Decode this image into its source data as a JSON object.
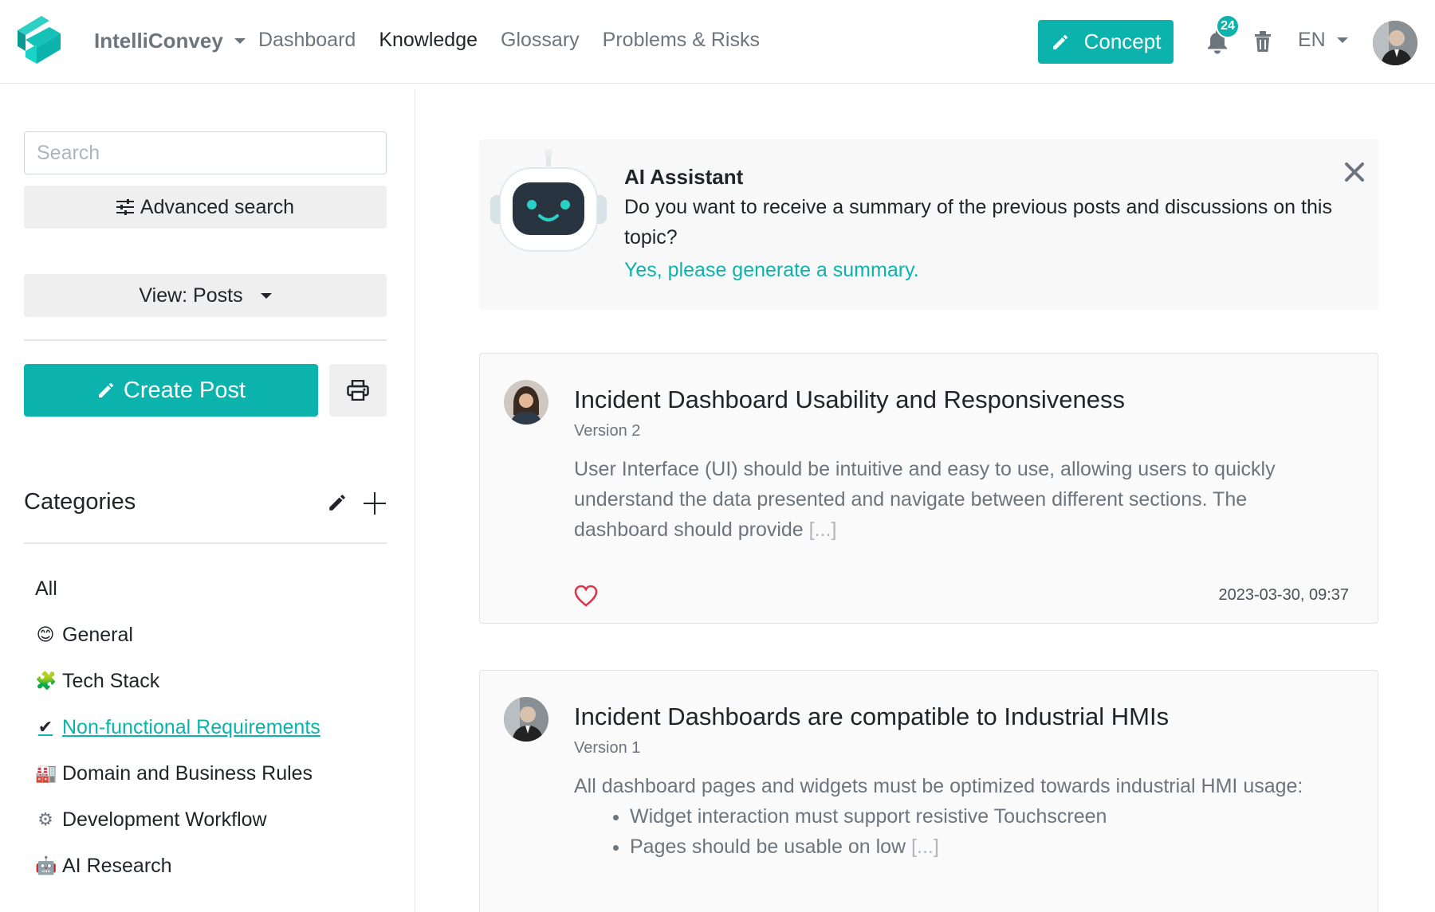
{
  "header": {
    "brand": "IntelliConvey",
    "nav": [
      "Dashboard",
      "Knowledge",
      "Glossary",
      "Problems & Risks"
    ],
    "active_nav": "Knowledge",
    "concept_label": "Concept",
    "notification_count": "24",
    "language": "EN"
  },
  "sidebar": {
    "search_placeholder": "Search",
    "advanced_search": "Advanced search",
    "view_label": "View: Posts",
    "create_post": "Create Post",
    "categories_title": "Categories",
    "categories": [
      {
        "emoji": "",
        "label": "All",
        "active": false
      },
      {
        "emoji": "😊",
        "label": "General",
        "active": false
      },
      {
        "emoji": "🧩",
        "label": "Tech Stack",
        "active": false
      },
      {
        "emoji": "✔",
        "label": "Non-functional Requirements",
        "active": true
      },
      {
        "emoji": "🏭",
        "label": "Domain and Business Rules",
        "active": false
      },
      {
        "emoji": "⚙",
        "label": "Development Workflow",
        "active": false
      },
      {
        "emoji": "🤖",
        "label": "AI Research",
        "active": false
      }
    ]
  },
  "ai_assistant": {
    "title": "AI Assistant",
    "text": "Do you want to receive a summary of the previous posts and discussions on this topic?",
    "link": "Yes, please generate a summary."
  },
  "posts": [
    {
      "title": "Incident Dashboard Usability and Responsiveness",
      "version": "Version 2",
      "body": "User Interface (UI) should be intuitive and easy to use, allowing users to quickly understand the data presented and navigate between different sections. The dashboard should provide",
      "ellipsis": "[...]",
      "date": "2023-03-30, 09:37"
    },
    {
      "title": "Incident Dashboards are compatible to Industrial HMIs",
      "version": "Version 1",
      "body": "All dashboard pages and widgets must be optimized towards industrial HMI usage:",
      "bullets": [
        "Widget interaction must support resistive Touchscreen",
        "Pages should be usable on low"
      ],
      "ellipsis": "[...]"
    }
  ],
  "colors": {
    "accent": "#0cb3ad",
    "muted": "#6c757d",
    "heart": "#dc3545"
  }
}
